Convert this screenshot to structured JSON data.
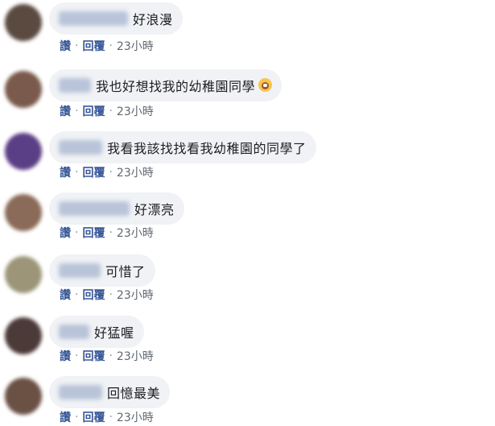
{
  "actions": {
    "like_label": "讚",
    "reply_label": "回覆",
    "separator": "·"
  },
  "comments": [
    {
      "text": "好浪漫",
      "time": "23小時",
      "avatar_color": "#5a4a40",
      "has_emoji": false
    },
    {
      "text": "我也好想找我的幼稚園同學",
      "time": "23小時",
      "avatar_color": "#7a5a4c",
      "has_emoji": true,
      "emoji": "scared-face-emoji"
    },
    {
      "text": "我看我該找找看我幼稚園的同學了",
      "time": "23小時",
      "avatar_color": "#5b3f86",
      "has_emoji": false
    },
    {
      "text": "好漂亮",
      "time": "23小時",
      "avatar_color": "#8a6a58",
      "has_emoji": false
    },
    {
      "text": "可惜了",
      "time": "23小時",
      "avatar_color": "#9c9578",
      "has_emoji": false
    },
    {
      "text": "好猛喔",
      "time": "23小時",
      "avatar_color": "#4c3a38",
      "has_emoji": false
    },
    {
      "text": "回憶最美",
      "time": "23小時",
      "avatar_color": "#6b5044",
      "has_emoji": false
    }
  ]
}
